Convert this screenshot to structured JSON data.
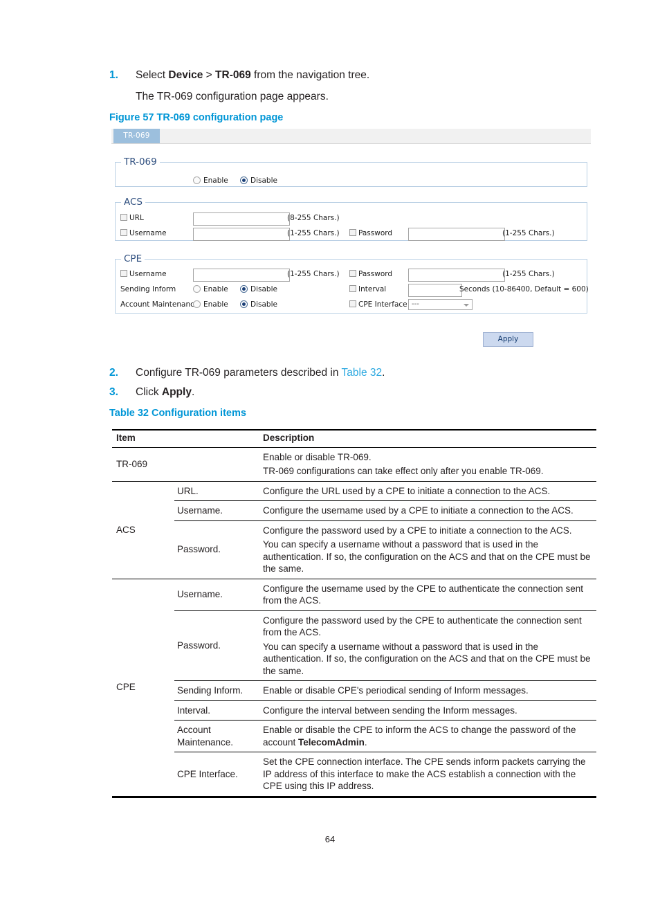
{
  "document": {
    "page_number": "64",
    "steps": [
      {
        "num": "1.",
        "text_before": "Select ",
        "bold1": "Device",
        "mid": " > ",
        "bold2": "TR-069",
        "text_after": " from the navigation tree.",
        "sub": "The TR-069 configuration page appears."
      },
      {
        "num": "2.",
        "text_before": "Configure TR-069 parameters described in ",
        "xref": "Table 32",
        "text_after": "."
      },
      {
        "num": "3.",
        "text_before": "Click ",
        "bold1": "Apply",
        "text_after": "."
      }
    ],
    "figure_caption": "Figure 57 TR-069 configuration page",
    "table_caption": "Table 32 Configuration items"
  },
  "screenshot": {
    "tab_label": "TR-069",
    "groups": {
      "tr069": {
        "legend": "TR-069",
        "enable_label": "Enable",
        "disable_label": "Disable",
        "selected": "Disable"
      },
      "acs": {
        "legend": "ACS",
        "url_label": "URL",
        "url_value": "",
        "url_hint": "(8-255 Chars.)",
        "username_label": "Username",
        "username_value": "",
        "username_hint": "(1-255 Chars.)",
        "password_label": "Password",
        "password_value": "",
        "password_hint": "(1-255 Chars.)"
      },
      "cpe": {
        "legend": "CPE",
        "username_label": "Username",
        "username_value": "",
        "username_hint": "(1-255 Chars.)",
        "password_label": "Password",
        "password_value": "",
        "password_hint": "(1-255 Chars.)",
        "sending_inform_label": "Sending Inform",
        "sending_inform_enable": "Enable",
        "sending_inform_disable": "Disable",
        "sending_inform_selected": "Disable",
        "interval_label": "Interval",
        "interval_value": "",
        "interval_hint": "Seconds (10-86400, Default = 600)",
        "account_maintenance_label": "Account Maintenance",
        "account_maintenance_enable": "Enable",
        "account_maintenance_disable": "Disable",
        "account_maintenance_selected": "Disable",
        "cpe_interface_label": "CPE Interface",
        "cpe_interface_value": "---"
      }
    },
    "apply_label": "Apply",
    "colors": {
      "tab_bg": "#9cbfdd",
      "group_border": "#b9cfe4",
      "legend_text": "#2f4f7f",
      "apply_bg": "#ccd9ef",
      "apply_text": "#123a6e"
    }
  },
  "table": {
    "headers": {
      "item": "Item",
      "description": "Description"
    },
    "rows": [
      {
        "item": "TR-069",
        "sub": "",
        "desc": [
          "Enable or disable TR-069.",
          "TR-069 configurations can take effect only after you enable TR-069."
        ]
      },
      {
        "item": "ACS",
        "sub": "URL.",
        "desc": [
          "Configure the URL used by a CPE to initiate a connection to the ACS."
        ]
      },
      {
        "item": "",
        "sub": "Username.",
        "desc": [
          "Configure the username used by a CPE to initiate a connection to the ACS."
        ]
      },
      {
        "item": "",
        "sub": "Password.",
        "desc": [
          "Configure the password used by a CPE to initiate a connection to the ACS.",
          "You can specify a username without a password that is used in the authentication. If so, the configuration on the ACS and that on the CPE must be the same."
        ]
      },
      {
        "item": "CPE",
        "sub": "Username.",
        "desc": [
          "Configure the username used by the CPE to authenticate the connection sent from the ACS."
        ]
      },
      {
        "item": "",
        "sub": "Password.",
        "desc": [
          "Configure the password used by the CPE to authenticate the connection sent from the ACS.",
          "You can specify a username without a password that is used in the authentication. If so, the configuration on the ACS and that on the CPE must be the same."
        ]
      },
      {
        "item": "",
        "sub": "Sending Inform.",
        "desc": [
          "Enable or disable CPE's periodical sending of Inform messages."
        ]
      },
      {
        "item": "",
        "sub": "Interval.",
        "desc": [
          "Configure the interval between sending the Inform messages."
        ]
      },
      {
        "item": "",
        "sub": "Account Maintenance.",
        "desc_prefix": "Enable or disable the CPE to inform the ACS to change the password of the account ",
        "desc_bold": "TelecomAdmin",
        "desc_suffix": "."
      },
      {
        "item": "",
        "sub": "CPE Interface.",
        "desc": [
          "Set the CPE connection interface. The CPE sends inform packets carrying the IP address of this interface to make the ACS establish a connection with the CPE using this IP address."
        ]
      }
    ]
  }
}
